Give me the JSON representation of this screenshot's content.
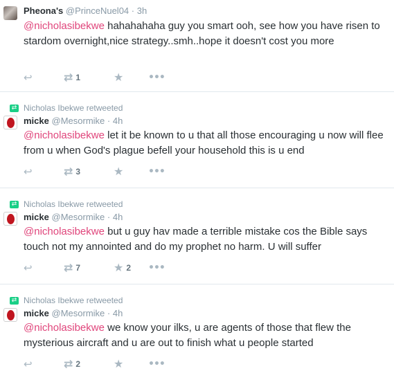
{
  "tweets": [
    {
      "retweeted_by": "",
      "fullname": "Pheona's",
      "username": "@PrinceNuel04",
      "dot": "·",
      "time": "3h",
      "mention": "@nicholasibekwe",
      "body": " hahahahaha guy you smart ooh, see how you have risen to stardom overnight,nice strategy..smh..hope it doesn't cost you more",
      "retweets": "1",
      "favorites": ""
    },
    {
      "retweeted_by": "Nicholas Ibekwe retweeted",
      "fullname": "micke",
      "username": "@Mesormike",
      "dot": "·",
      "time": "4h",
      "mention": "@nicholasibekwe",
      "body": " let it be known to u that all those encouraging u now will flee from u when God's plague befell your household this is u end",
      "retweets": "3",
      "favorites": ""
    },
    {
      "retweeted_by": "Nicholas Ibekwe retweeted",
      "fullname": "micke",
      "username": "@Mesormike",
      "dot": "·",
      "time": "4h",
      "mention": "@nicholasibekwe",
      "body": " but u guy hav made a terrible mistake cos the Bible says touch not my annointed and do my prophet no harm. U will suffer",
      "retweets": "7",
      "favorites": "2"
    },
    {
      "retweeted_by": "Nicholas Ibekwe retweeted",
      "fullname": "micke",
      "username": "@Mesormike",
      "dot": "·",
      "time": "4h",
      "mention": "@nicholasibekwe",
      "body": " we know your ilks, u are agents of those that flew the mysterious aircraft and u are out to finish what u people started",
      "retweets": "2",
      "favorites": ""
    }
  ],
  "icons": {
    "reply": "reply-icon",
    "retweet": "retweet-icon",
    "favorite": "star-icon",
    "more": "more-icon"
  },
  "colors": {
    "mention": "#e0457b",
    "retweet_badge": "#19cf86",
    "muted": "#8899a6"
  }
}
